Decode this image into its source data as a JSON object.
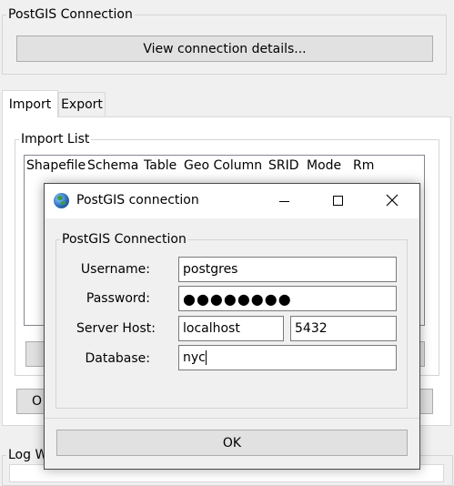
{
  "main": {
    "connection_group": {
      "legend": "PostGIS Connection",
      "view_details_label": "View connection details..."
    },
    "tabs": [
      {
        "label": "Import",
        "active": true
      },
      {
        "label": "Export",
        "active": false
      }
    ],
    "import_list": {
      "legend": "Import List",
      "columns": [
        "Shapefile",
        "Schema",
        "Table",
        "Geo Column",
        "SRID",
        "Mode",
        "Rm"
      ]
    },
    "partial_button_label": "O",
    "log_legend_partial": "Log W"
  },
  "dialog": {
    "title": "PostGIS connection",
    "controls": {
      "minimize": "—",
      "maximize": "□",
      "close": "✕"
    },
    "group_legend": "PostGIS Connection",
    "fields": {
      "username_label": "Username:",
      "username_value": "postgres",
      "password_label": "Password:",
      "password_value": "●●●●●●●●",
      "host_label": "Server Host:",
      "host_value": "localhost",
      "port_value": "5432",
      "database_label": "Database:",
      "database_value": "nyc"
    },
    "ok_label": "OK"
  }
}
